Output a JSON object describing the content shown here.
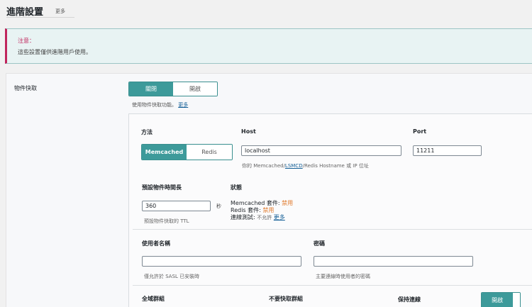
{
  "header": {
    "title": "進階設置",
    "more_tab": "更多"
  },
  "notice": {
    "title": "注意：",
    "text": "這些設置僅供進階用戶使用。"
  },
  "object_cache": {
    "section_label": "物件快取",
    "toggle": {
      "off_label": "關閉",
      "on_label": "開啟",
      "selected": "關閉"
    },
    "help_text": "使用物件快取功能。",
    "help_link": "更多"
  },
  "method": {
    "label": "方法",
    "options": [
      "Memcached",
      "Redis"
    ],
    "selected": "Memcached"
  },
  "host": {
    "label": "Host",
    "value": "localhost",
    "help_prefix": "你的 Memcached/",
    "help_link": "LSMCD",
    "help_suffix": "/Redis Hostname 或 IP 位址"
  },
  "port": {
    "label": "Port",
    "value": "11211"
  },
  "ttl": {
    "label": "預設物件時間長",
    "value": "360",
    "unit": "秒",
    "help": "預設物件快取的 TTL"
  },
  "status": {
    "label": "狀態",
    "memcached_label": "Memcached 套件:",
    "memcached_value": "禁用",
    "redis_label": "Redis 套件:",
    "redis_value": "禁用",
    "connection_label": "連線測試:",
    "connection_value": "不允許",
    "connection_link": "更多"
  },
  "username": {
    "label": "使用者名稱",
    "value": "",
    "help": "僅允許於 SASL 已安裝時"
  },
  "password": {
    "label": "密碼",
    "value": "",
    "help": "主要連線時使用者的密碼"
  },
  "bottom_row": {
    "global_groups": "全域群組",
    "no_cache_groups": "不要快取群組",
    "keep_connection": "保持連線",
    "keep_toggle_label": "開啟"
  },
  "colors": {
    "accent": "#3d9a9a",
    "notice_border": "#c0245b",
    "status_disabled": "#e07a2c",
    "link": "#135e96"
  }
}
